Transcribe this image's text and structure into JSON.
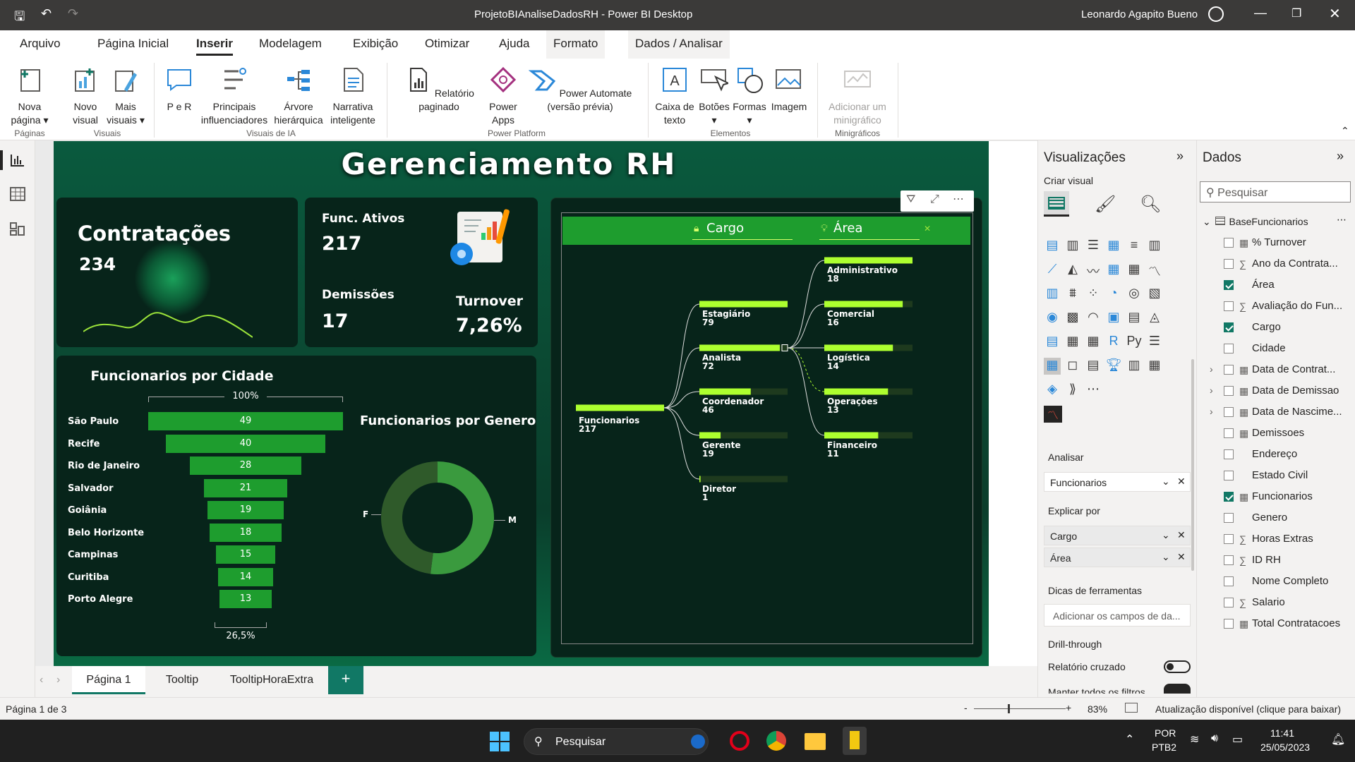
{
  "window": {
    "title": "ProjetoBIAnaliseDadosRH - Power BI Desktop",
    "user": "Leonardo Agapito Bueno"
  },
  "menu": [
    "Arquivo",
    "Página Inicial",
    "Inserir",
    "Modelagem",
    "Exibição",
    "Otimizar",
    "Ajuda",
    "Formato",
    "Dados / Analisar"
  ],
  "ribbon": {
    "nova_pagina": "Nova página",
    "novo_visual": "Novo visual",
    "mais_visuais": "Mais visuais",
    "pe_r": "P e R",
    "principais": "Principais influenciadores",
    "arvore": "Árvore hierárquica",
    "narrativa": "Narrativa inteligente",
    "relatorio": "Relatório paginado",
    "power_apps": "Power Apps",
    "power_automate": "Power Automate (versão prévia)",
    "caixa_texto": "Caixa de texto",
    "botoes": "Botões",
    "formas": "Formas",
    "imagem": "Imagem",
    "minigrafico": "Adicionar um minigráfico",
    "groups": {
      "paginas": "Páginas",
      "visuais": "Visuais",
      "ia": "Visuais de IA",
      "platform": "Power Platform",
      "elementos": "Elementos",
      "minigraficos": "Minigráficos"
    }
  },
  "report": {
    "title": "Gerenciamento RH",
    "contratacoes_label": "Contratações",
    "contratacoes_value": "234",
    "ativos_label": "Func. Ativos",
    "ativos_value": "217",
    "demissoes_label": "Demissões",
    "demissoes_value": "17",
    "turnover_label": "Turnover",
    "turnover_value": "7,26%",
    "funnel_title": "Funcionarios por Cidade",
    "funnel_top": "100%",
    "funnel_bottom": "26,5%",
    "donut_title": "Funcionarios por Genero",
    "donut_f": "F",
    "donut_m": "M",
    "tree_hdr_cargo": "Cargo",
    "tree_hdr_area": "Área"
  },
  "chart_data": [
    {
      "type": "bar",
      "title": "Funcionarios por Cidade",
      "categories": [
        "São Paulo",
        "Recife",
        "Rio de Janeiro",
        "Salvador",
        "Goiânia",
        "Belo Horizonte",
        "Campinas",
        "Curitiba",
        "Porto Alegre"
      ],
      "values": [
        49,
        40,
        28,
        21,
        19,
        18,
        15,
        14,
        13
      ]
    },
    {
      "type": "pie",
      "title": "Funcionarios por Genero",
      "categories": [
        "F",
        "M"
      ],
      "values": [
        48,
        52
      ]
    },
    {
      "type": "table",
      "title": "Decomposition tree",
      "root": {
        "label": "Funcionarios",
        "value": 217
      },
      "cargo": [
        {
          "label": "Estagiário",
          "value": 79
        },
        {
          "label": "Analista",
          "value": 72
        },
        {
          "label": "Coordenador",
          "value": 46
        },
        {
          "label": "Gerente",
          "value": 19
        },
        {
          "label": "Diretor",
          "value": 1
        }
      ],
      "area": [
        {
          "label": "Administrativo",
          "value": 18
        },
        {
          "label": "Comercial",
          "value": 16
        },
        {
          "label": "Logística",
          "value": 14
        },
        {
          "label": "Operações",
          "value": 13
        },
        {
          "label": "Financeiro",
          "value": 11
        }
      ]
    }
  ],
  "viz_pane": {
    "title": "Visualizações",
    "criar": "Criar visual",
    "analisar": "Analisar",
    "analisar_val": "Funcionarios",
    "explicar": "Explicar por",
    "explicar_1": "Cargo",
    "explicar_2": "Área",
    "dicas": "Dicas de ferramentas",
    "dicas_ph": "Adicionar os campos de da...",
    "drill": "Drill-through",
    "relatorio_cruzado": "Relatório cruzado",
    "manter": "Manter todos os filtros"
  },
  "data_pane": {
    "title": "Dados",
    "search": "Pesquisar",
    "table": "BaseFuncionarios",
    "fields": [
      {
        "name": "% Turnover",
        "checked": false,
        "icon": "calc"
      },
      {
        "name": "Ano da Contrata...",
        "checked": false,
        "icon": "sigma"
      },
      {
        "name": "Área",
        "checked": true,
        "icon": ""
      },
      {
        "name": "Avaliação do Fun...",
        "checked": false,
        "icon": "sigma"
      },
      {
        "name": "Cargo",
        "checked": true,
        "icon": ""
      },
      {
        "name": "Cidade",
        "checked": false,
        "icon": ""
      },
      {
        "name": "Data de Contrat...",
        "checked": false,
        "icon": "cal"
      },
      {
        "name": "Data de Demissao",
        "checked": false,
        "icon": "cal"
      },
      {
        "name": "Data de Nascime...",
        "checked": false,
        "icon": "cal"
      },
      {
        "name": "Demissoes",
        "checked": false,
        "icon": "calc"
      },
      {
        "name": "Endereço",
        "checked": false,
        "icon": ""
      },
      {
        "name": "Estado Civil",
        "checked": false,
        "icon": ""
      },
      {
        "name": "Funcionarios",
        "checked": true,
        "icon": "calc"
      },
      {
        "name": "Genero",
        "checked": false,
        "icon": ""
      },
      {
        "name": "Horas Extras",
        "checked": false,
        "icon": "sigma"
      },
      {
        "name": "ID RH",
        "checked": false,
        "icon": "sigma"
      },
      {
        "name": "Nome Completo",
        "checked": false,
        "icon": ""
      },
      {
        "name": "Salario",
        "checked": false,
        "icon": "sigma"
      },
      {
        "name": "Total Contratacoes",
        "checked": false,
        "icon": "calc"
      }
    ]
  },
  "tabs": [
    "Página 1",
    "Tooltip",
    "TooltipHoraExtra"
  ],
  "status": {
    "page": "Página 1 de 3",
    "zoom": "83%",
    "update": "Atualização disponível (clique para baixar)"
  },
  "taskbar": {
    "search": "Pesquisar",
    "lang1": "POR",
    "lang2": "PTB2",
    "time": "11:41",
    "date": "25/05/2023"
  }
}
